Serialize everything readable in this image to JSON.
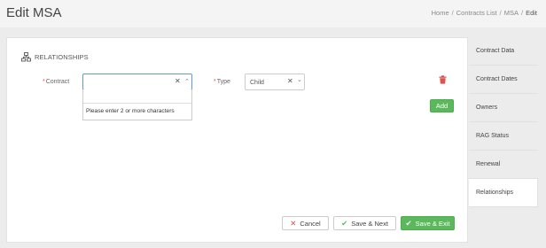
{
  "header": {
    "title": "Edit MSA",
    "breadcrumb": [
      "Home",
      "Contracts List",
      "MSA",
      "Edit"
    ],
    "separator": "/"
  },
  "section": {
    "title": "RELATIONSHIPS",
    "icon": "sitemap-icon"
  },
  "form": {
    "contract_label": "Contract",
    "contract_value": "",
    "contract_dropdown_message": "Please enter 2 or more characters",
    "type_label": "Type",
    "type_value": "Child",
    "required_marker": "*",
    "clear_glyph": "✕",
    "chevron_up_glyph": "⌃",
    "chevron_down_glyph": "⌄",
    "add_label": "Add"
  },
  "footer": {
    "cancel_label": "Cancel",
    "save_next_label": "Save & Next",
    "save_exit_label": "Save & Exit",
    "cancel_glyph": "✕",
    "check_glyph": "✔"
  },
  "sidebar": {
    "tabs": [
      {
        "label": "Contract Data",
        "active": false
      },
      {
        "label": "Contract Dates",
        "active": false
      },
      {
        "label": "Owners",
        "active": false
      },
      {
        "label": "RAG Status",
        "active": false
      },
      {
        "label": "Renewal",
        "active": false
      },
      {
        "label": "Relationships",
        "active": true
      }
    ]
  },
  "colors": {
    "accent_green": "#5cb85c",
    "danger_red": "#d9534f",
    "required_red": "#e74c3c",
    "focus_blue": "#5b9bd5"
  }
}
